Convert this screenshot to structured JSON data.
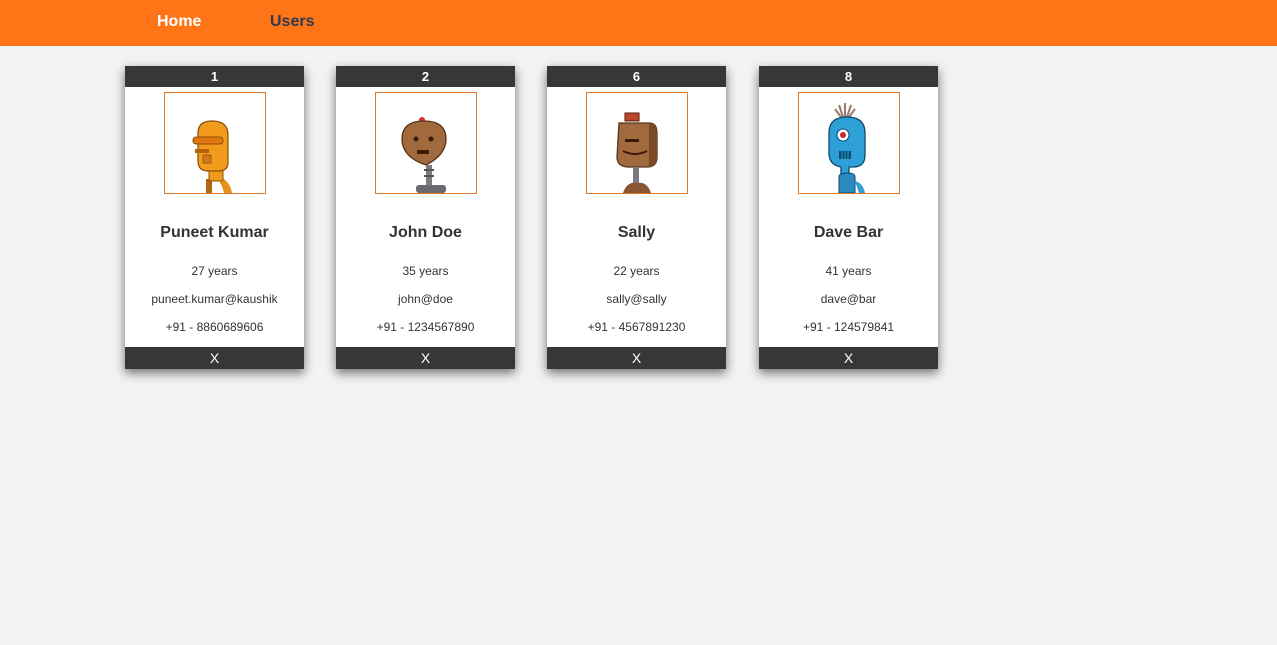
{
  "nav": {
    "home_label": "Home",
    "users_label": "Users"
  },
  "users": [
    {
      "id": "1",
      "name": "Puneet Kumar",
      "age": "27 years",
      "email": "puneet.kumar@kaushik",
      "phone": "+91 - 8860689606",
      "remove_label": "X",
      "avatar": "orange-robot-avatar"
    },
    {
      "id": "2",
      "name": "John Doe",
      "age": "35 years",
      "email": "john@doe",
      "phone": "+91 - 1234567890",
      "remove_label": "X",
      "avatar": "brown-robot-avatar"
    },
    {
      "id": "6",
      "name": "Sally",
      "age": "22 years",
      "email": "sally@sally",
      "phone": "+91 - 4567891230",
      "remove_label": "X",
      "avatar": "brown-bucket-robot-avatar"
    },
    {
      "id": "8",
      "name": "Dave Bar",
      "age": "41 years",
      "email": "dave@bar",
      "phone": "+91 - 124579841",
      "remove_label": "X",
      "avatar": "blue-robot-avatar"
    }
  ],
  "colors": {
    "navbar": "#ff7416",
    "card_header": "#383636",
    "page_background": "#f3f3f3"
  }
}
